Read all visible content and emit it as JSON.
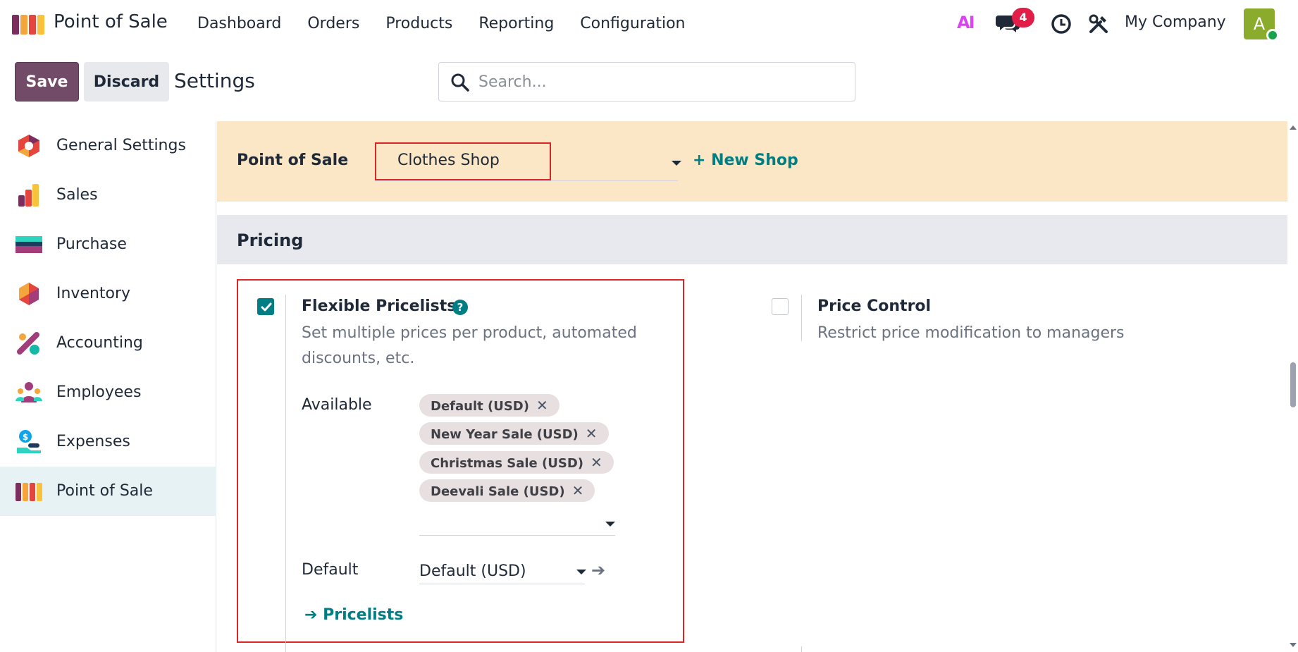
{
  "app": {
    "name": "Point of Sale",
    "logo_icon": "pos-shop-icon"
  },
  "menu": [
    "Dashboard",
    "Orders",
    "Products",
    "Reporting",
    "Configuration"
  ],
  "topbar": {
    "ai_label": "AI",
    "messages_badge": "4",
    "company": "My Company",
    "avatar_letter": "A"
  },
  "control": {
    "save_label": "Save",
    "discard_label": "Discard",
    "title": "Settings",
    "search_placeholder": "Search..."
  },
  "sidebar": {
    "items": [
      {
        "label": "General Settings",
        "icon": "general-settings-icon"
      },
      {
        "label": "Sales",
        "icon": "sales-icon"
      },
      {
        "label": "Purchase",
        "icon": "purchase-icon"
      },
      {
        "label": "Inventory",
        "icon": "inventory-icon"
      },
      {
        "label": "Accounting",
        "icon": "accounting-icon"
      },
      {
        "label": "Employees",
        "icon": "employees-icon"
      },
      {
        "label": "Expenses",
        "icon": "expenses-icon"
      },
      {
        "label": "Point of Sale",
        "icon": "pos-icon",
        "active": true
      }
    ]
  },
  "pos_bar": {
    "label": "Point of Sale",
    "shop_value": "Clothes Shop",
    "new_shop_label": "+ New Shop"
  },
  "pricing": {
    "section_title": "Pricing",
    "flexible": {
      "title": "Flexible Pricelists",
      "help": "?",
      "desc": "Set multiple prices per product, automated discounts, etc.",
      "checked": true,
      "available_label": "Available",
      "tags": [
        "Default (USD)",
        "New Year Sale (USD)",
        "Christmas Sale (USD)",
        "Deevali Sale (USD)"
      ],
      "default_label": "Default",
      "default_value": "Default (USD)",
      "pricelists_link": "Pricelists"
    },
    "price_control": {
      "title": "Price Control",
      "desc": "Restrict price modification to managers",
      "checked": false
    }
  },
  "colors": {
    "primary": "#714b67",
    "link": "#017e84",
    "highlight": "#dc2626",
    "pos_bar": "#fbe7c6"
  }
}
